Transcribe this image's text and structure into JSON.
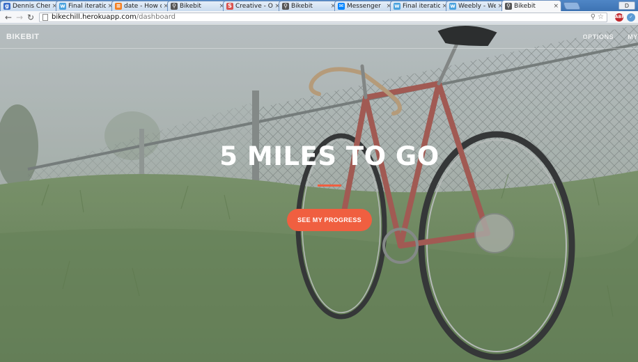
{
  "browser": {
    "tabs": [
      {
        "title": "Dennis Chen",
        "favicon": "google-plus-icon",
        "color": "#3b6ec9",
        "active": false
      },
      {
        "title": "Final iteration",
        "favicon": "weebly-icon",
        "color": "#4aa3df",
        "active": false
      },
      {
        "title": "date - How d",
        "favicon": "stackoverflow-icon",
        "color": "#f48024",
        "active": false
      },
      {
        "title": "Bikebit",
        "favicon": "bike-icon",
        "color": "#555555",
        "active": false
      },
      {
        "title": "Creative - On",
        "favicon": "s-icon",
        "color": "#d9534f",
        "active": false
      },
      {
        "title": "Bikebit",
        "favicon": "bike-icon",
        "color": "#555555",
        "active": false
      },
      {
        "title": "Messenger",
        "favicon": "messenger-icon",
        "color": "#0084ff",
        "active": false
      },
      {
        "title": "Final iteration",
        "favicon": "weebly-icon",
        "color": "#4aa3df",
        "active": false
      },
      {
        "title": "Weebly - Web",
        "favicon": "weebly-icon",
        "color": "#4aa3df",
        "active": false
      },
      {
        "title": "Bikebit",
        "favicon": "bike-icon",
        "color": "#555555",
        "active": true
      }
    ],
    "url_host": "bikechill.herokuapp.com",
    "url_path": "/dashboard",
    "window_label": "D"
  },
  "site": {
    "brand": "BIKEBIT",
    "nav": [
      "OPTIONS",
      "MY"
    ]
  },
  "hero": {
    "heading": "5 MILES TO GO",
    "cta_label": "SEE MY PROGRESS"
  },
  "colors": {
    "accent": "#f05f40"
  }
}
